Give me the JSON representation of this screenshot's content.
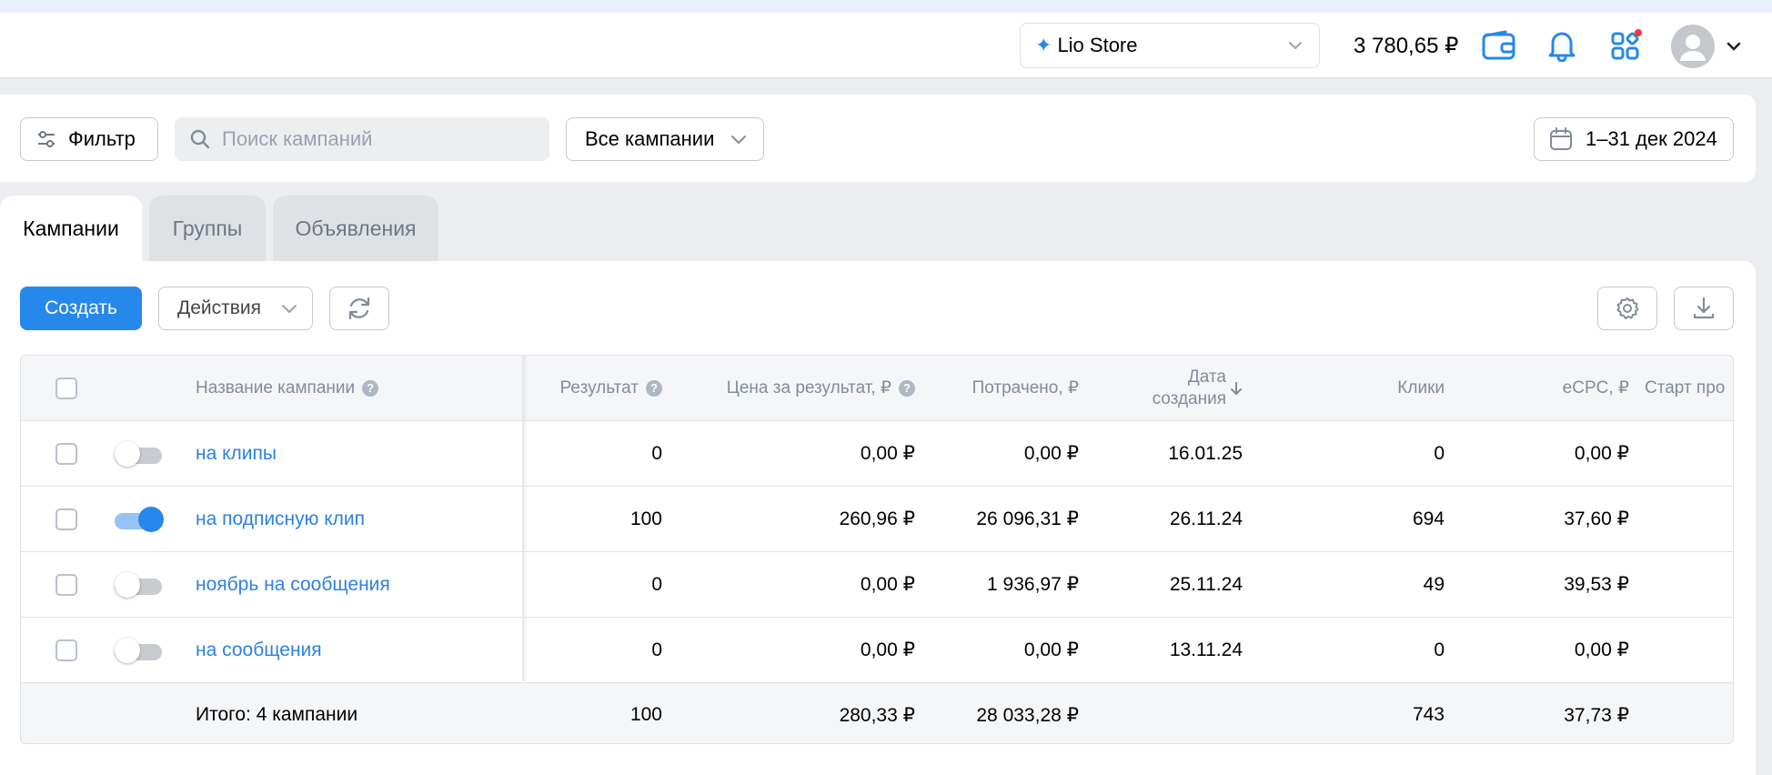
{
  "header": {
    "store_name": "Lio Store",
    "balance": "3 780,65 ₽",
    "notification_dot_color": "#ff3347"
  },
  "toolbar": {
    "filter_label": "Фильтр",
    "search_placeholder": "Поиск кампаний",
    "campaign_scope": "Все кампании",
    "date_range": "1–31 дек 2024"
  },
  "tabs": [
    {
      "label": "Кампании",
      "active": true
    },
    {
      "label": "Группы",
      "active": false
    },
    {
      "label": "Объявления",
      "active": false
    }
  ],
  "actions": {
    "create_label": "Создать",
    "actions_label": "Действия"
  },
  "table": {
    "columns": {
      "name": "Название кампании",
      "result": "Результат",
      "cost_per_result": "Цена за результат, ₽",
      "spent": "Потрачено, ₽",
      "created_line1": "Дата",
      "created_line2": "создания",
      "clicks": "Клики",
      "ecpc": "eCPC, ₽",
      "start": "Старт про"
    },
    "rows": [
      {
        "name": "на клипы",
        "enabled": false,
        "result": "0",
        "cost_per_result": "0,00 ₽",
        "spent": "0,00 ₽",
        "created": "16.01.25",
        "clicks": "0",
        "ecpc": "0,00 ₽"
      },
      {
        "name": "на подписную клип",
        "enabled": true,
        "result": "100",
        "cost_per_result": "260,96 ₽",
        "spent": "26 096,31 ₽",
        "created": "26.11.24",
        "clicks": "694",
        "ecpc": "37,60 ₽"
      },
      {
        "name": "ноябрь на сообщения",
        "enabled": false,
        "result": "0",
        "cost_per_result": "0,00 ₽",
        "spent": "1 936,97 ₽",
        "created": "25.11.24",
        "clicks": "49",
        "ecpc": "39,53 ₽"
      },
      {
        "name": "на сообщения",
        "enabled": false,
        "result": "0",
        "cost_per_result": "0,00 ₽",
        "spent": "0,00 ₽",
        "created": "13.11.24",
        "clicks": "0",
        "ecpc": "0,00 ₽"
      }
    ],
    "total": {
      "label": "Итого: 4 кампании",
      "result": "100",
      "cost_per_result": "280,33 ₽",
      "spent": "28 033,28 ₽",
      "clicks": "743",
      "ecpc": "37,73 ₽"
    }
  }
}
